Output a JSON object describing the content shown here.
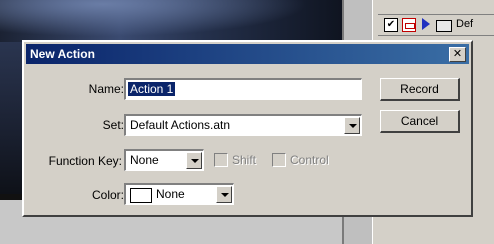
{
  "actions_panel": {
    "check_mark": "✔",
    "set_label": "Def"
  },
  "dialog": {
    "title": "New Action",
    "close_glyph": "✕",
    "name": {
      "label": "Name:",
      "value": "Action 1"
    },
    "set": {
      "label": "Set:",
      "value": "Default Actions.atn"
    },
    "function_key": {
      "label": "Function Key:",
      "value": "None"
    },
    "shift": {
      "label": "Shift",
      "checked": false,
      "enabled": false
    },
    "control": {
      "label": "Control",
      "checked": false,
      "enabled": false
    },
    "color": {
      "label": "Color:",
      "value": "None"
    },
    "buttons": {
      "record": "Record",
      "cancel": "Cancel"
    }
  }
}
